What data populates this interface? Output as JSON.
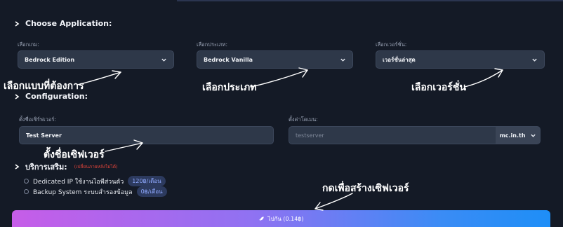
{
  "application": {
    "title": "Choose Application:",
    "fields": [
      {
        "label": "เลือกเกม:",
        "value": "Bedrock Edition"
      },
      {
        "label": "เลือกประเภท:",
        "value": "Bedrock Vanilla"
      },
      {
        "label": "เลือกเวอร์ชั่น:",
        "value": "เวอร์ชั่นล่าสุด"
      }
    ]
  },
  "configuration": {
    "title": "Configuration:",
    "server_name": {
      "label": "ตั้งชื่อเซิร์ฟเวอร์:",
      "value": "Test Server"
    },
    "domain": {
      "label": "ตั้งค่าโดเมน:",
      "placeholder": "testserver",
      "suffix": "mc.in.th"
    }
  },
  "addons": {
    "title": "บริการเสริม:",
    "note": "(เปลี่ยนภายหลังไม่ได้)",
    "items": [
      {
        "label": "Dedicated IP ใช้งานไอพีส่วนตัว",
        "price": "120฿/เดือน"
      },
      {
        "label": "Backup System ระบบสำรองข้อมูล",
        "price": "0฿/เดือน"
      }
    ]
  },
  "submit": {
    "label": "ไปกัน (0.14฿)"
  },
  "annotations": {
    "game": "เลือกแบบที่ต้องการ",
    "type": "เลือกประเภท",
    "version": "เลือกเวอร์ชั่น",
    "server_name": "ตั้งชื่อเซิฟเวอร์",
    "create": "กดเพื่อสร้างเซิฟเวอร์"
  },
  "colors": {
    "background": "#141a26",
    "field": "#2e3849",
    "accent_price": "#8fa9ff",
    "warn": "#e0443a"
  },
  "icons": [
    "chevron-right-icon",
    "chevron-down-icon",
    "rocket-icon"
  ]
}
